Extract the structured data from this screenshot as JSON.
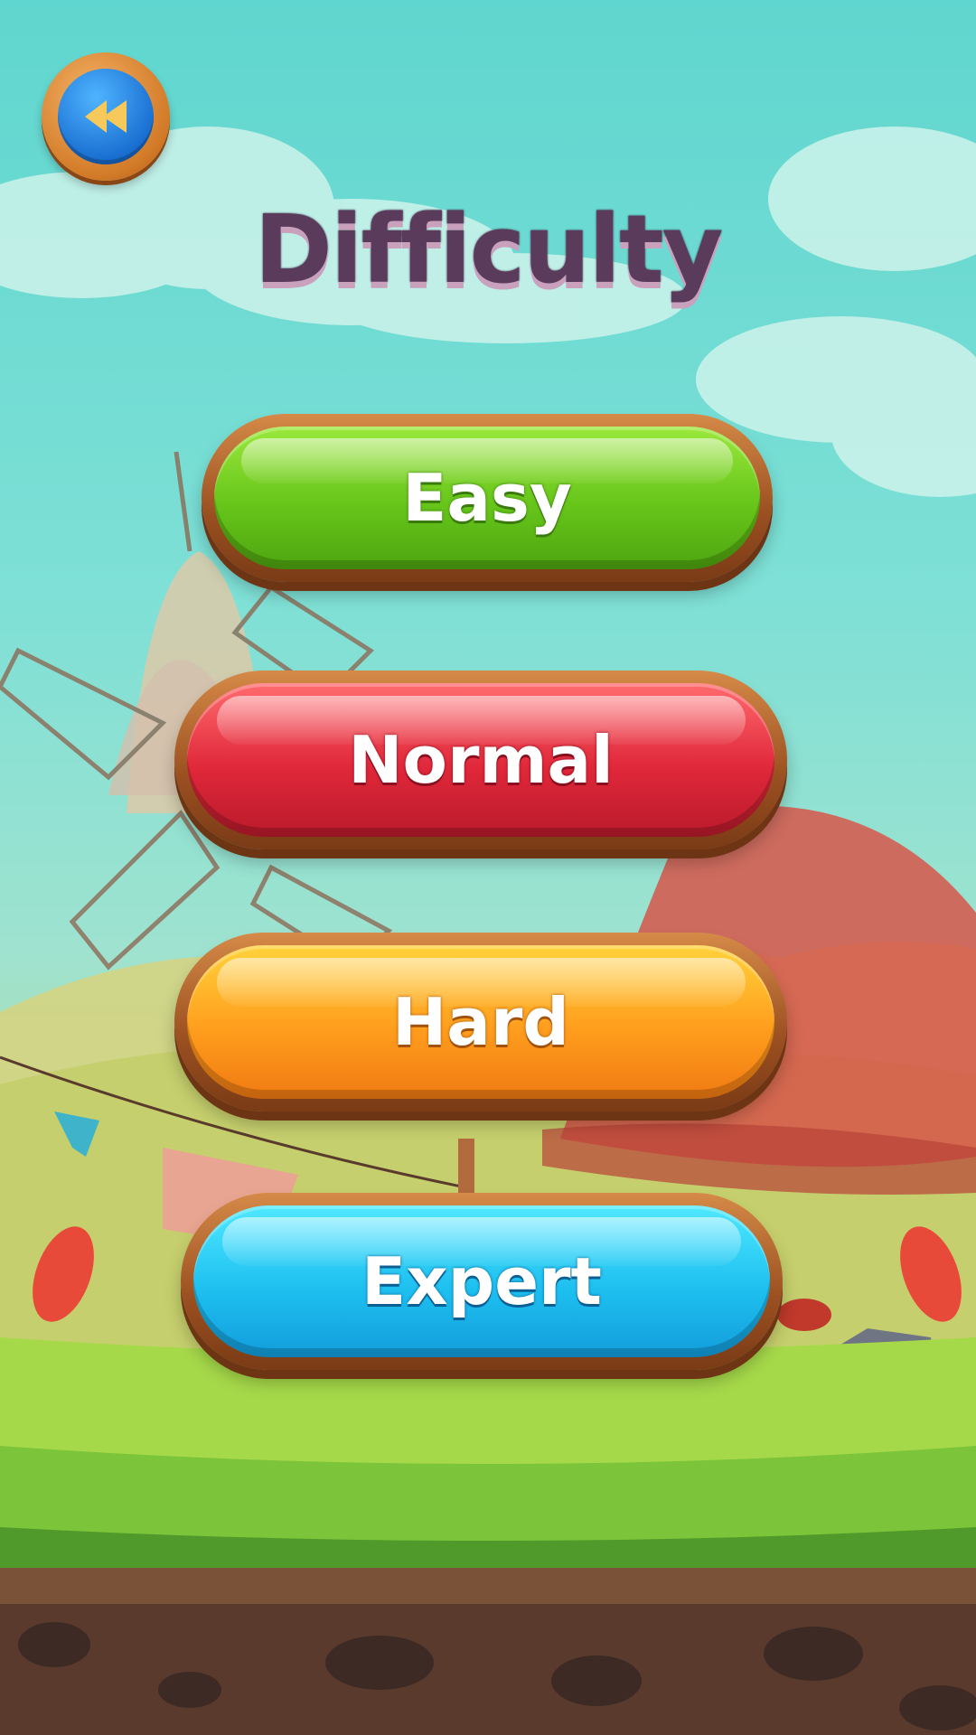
{
  "screen": {
    "title": "Difficulty"
  },
  "back_button": {
    "icon": "rewind-back-icon"
  },
  "difficulty_options": [
    {
      "label": "Easy",
      "color": "#67c51a"
    },
    {
      "label": "Normal",
      "color": "#e0283a"
    },
    {
      "label": "Hard",
      "color": "#ff9d1d"
    },
    {
      "label": "Expert",
      "color": "#1ec0f0"
    }
  ],
  "colors": {
    "title": "#5a3b5c",
    "frame_wood": "#9a4f20",
    "sky": "#7fe0d6",
    "grass": "#7cc43a",
    "soil": "#5a3a2c"
  }
}
